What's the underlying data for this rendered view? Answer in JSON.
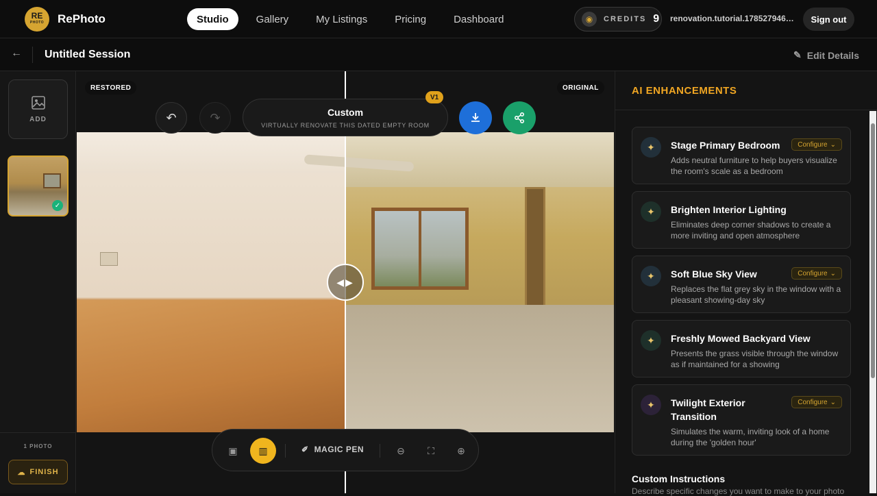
{
  "header": {
    "logo_text": "RE",
    "logo_sub": "PHOTO",
    "brand": "RePhoto",
    "nav": [
      {
        "label": "Studio",
        "active": true
      },
      {
        "label": "Gallery",
        "active": false
      },
      {
        "label": "My Listings",
        "active": false
      },
      {
        "label": "Pricing",
        "active": false
      },
      {
        "label": "Dashboard",
        "active": false
      }
    ],
    "credits_label": "CREDITS",
    "credits_count": "9",
    "user": "renovation.tutorial.1785279469...",
    "signout": "Sign out"
  },
  "session": {
    "title": "Untitled Session",
    "edit_details": "Edit Details"
  },
  "left": {
    "add_label": "ADD",
    "photo_count": "1 PHOTO",
    "finish": "FINISH"
  },
  "stage": {
    "restored_label": "RESTORED",
    "original_label": "ORIGINAL",
    "prompt_title": "Custom",
    "prompt_sub": "VIRTUALLY RENOVATE THIS DATED EMPTY ROOM",
    "version": "V1",
    "magic_pen": "MAGIC PEN"
  },
  "right": {
    "title": "AI ENHANCEMENTS",
    "cards": [
      {
        "title": "Stage Primary Bedroom",
        "desc": "Adds neutral furniture to help buyers visualize the room's scale as a bedroom",
        "configure": "Configure"
      },
      {
        "title": "Brighten Interior Lighting",
        "desc": "Eliminates deep corner shadows to create a more inviting and open atmosphere",
        "configure": ""
      },
      {
        "title": "Soft Blue Sky View",
        "desc": "Replaces the flat grey sky in the window with a pleasant showing-day sky",
        "configure": "Configure"
      },
      {
        "title": "Freshly Mowed Backyard View",
        "desc": "Presents the grass visible through the window as if maintained for a showing",
        "configure": ""
      },
      {
        "title": "Twilight Exterior Transition",
        "desc": "Simulates the warm, inviting look of a home during the 'golden hour'",
        "configure": "Configure"
      }
    ],
    "custom_title": "Custom Instructions",
    "custom_desc": "Describe specific changes you want to make to your photo"
  },
  "colors": {
    "accent": "#f0a623",
    "download": "#1e6fd9",
    "share": "#1aa06a",
    "check": "#19b27a"
  }
}
